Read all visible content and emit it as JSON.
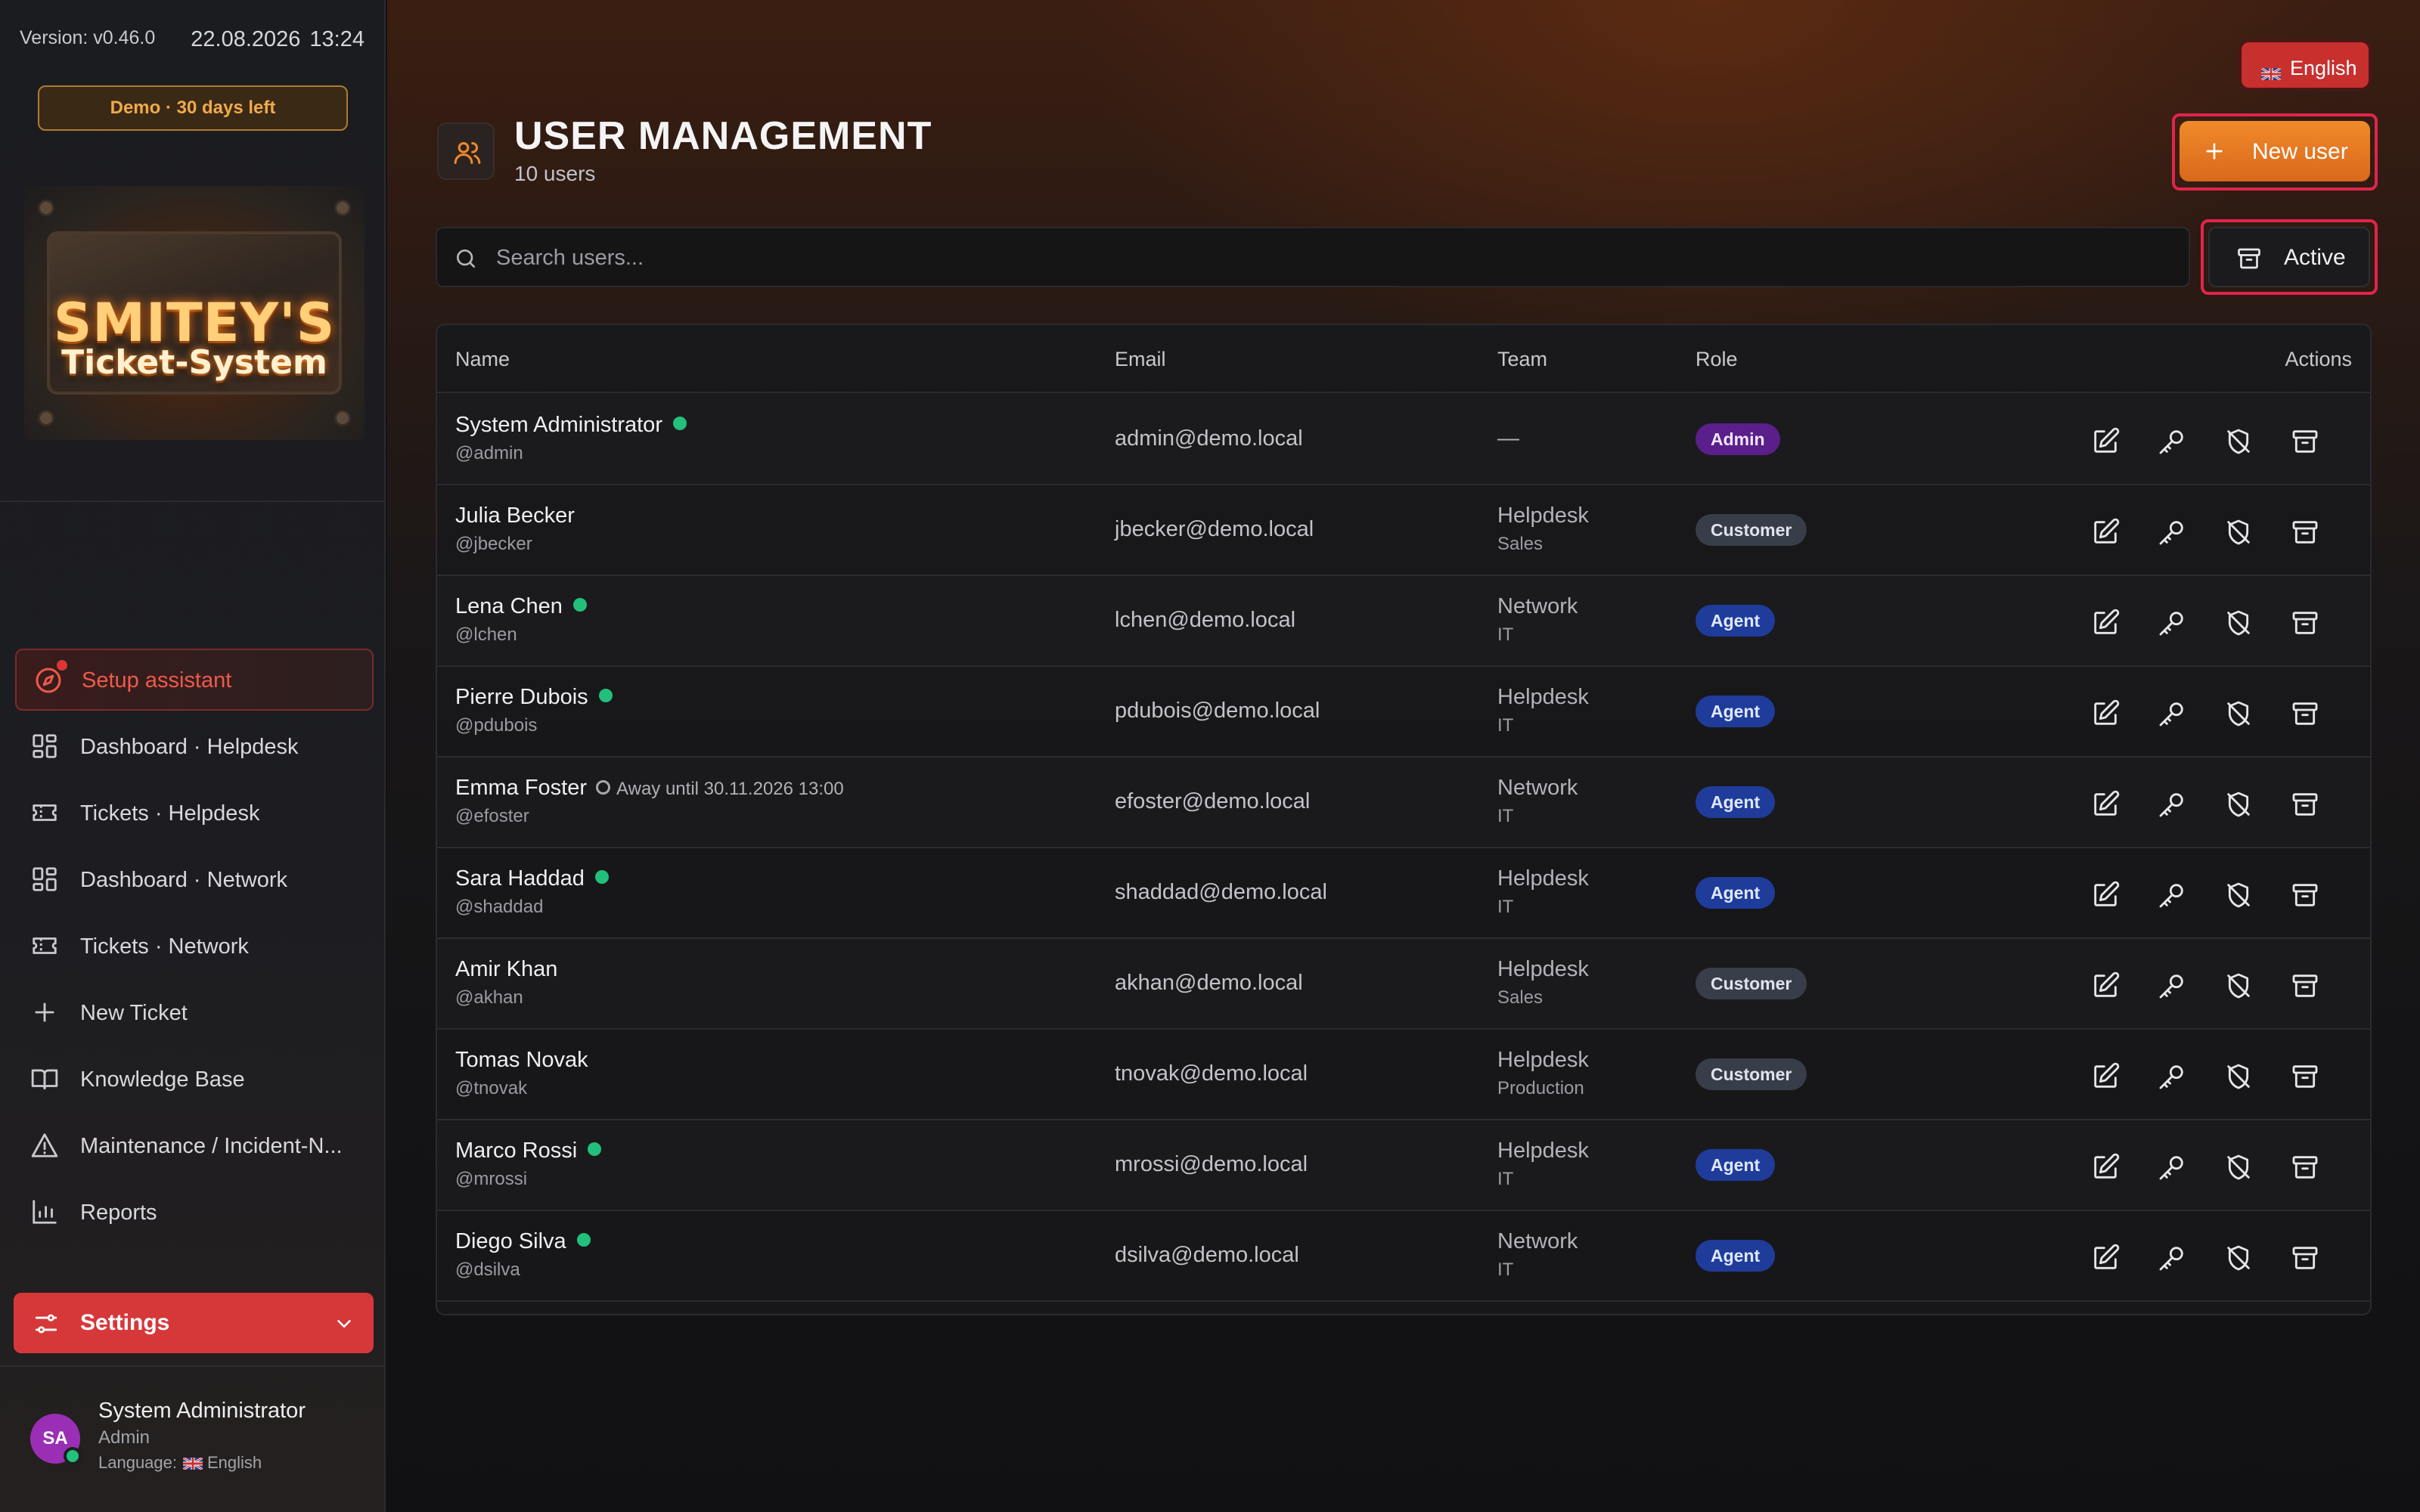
{
  "sidebar": {
    "version": "Version: v0.46.0",
    "date": "22.08.2026",
    "time": "13:24",
    "demo_badge": "Demo · 30 days left",
    "logo_line1": "SMITEY'S",
    "logo_line2": "Ticket-System",
    "setup": "Setup assistant",
    "nav": [
      {
        "label": "Dashboard · Helpdesk",
        "icon": "dashboard-icon"
      },
      {
        "label": "Tickets · Helpdesk",
        "icon": "ticket-icon"
      },
      {
        "label": "Dashboard · Network",
        "icon": "dashboard-icon"
      },
      {
        "label": "Tickets · Network",
        "icon": "ticket-icon"
      },
      {
        "label": "New Ticket",
        "icon": "plus-icon"
      },
      {
        "label": "Knowledge Base",
        "icon": "book-icon"
      },
      {
        "label": "Maintenance / Incident-N...",
        "icon": "warning-icon"
      },
      {
        "label": "Reports",
        "icon": "chart-icon"
      }
    ],
    "settings": "Settings",
    "user": {
      "initials": "SA",
      "name": "System Administrator",
      "role": "Admin",
      "language_label": "Language:",
      "language": "English"
    }
  },
  "header": {
    "language_button": "English",
    "title": "USER MANAGEMENT",
    "subtitle": "10 users",
    "new_user": "New user",
    "search_placeholder": "Search users...",
    "filter": "Active"
  },
  "table": {
    "columns": [
      "Name",
      "Email",
      "Team",
      "Role",
      "Actions"
    ],
    "rows": [
      {
        "name": "System Administrator",
        "handle": "@admin",
        "email": "admin@demo.local",
        "team": "—",
        "team_sub": "",
        "role": "Admin",
        "status": "online"
      },
      {
        "name": "Julia Becker",
        "handle": "@jbecker",
        "email": "jbecker@demo.local",
        "team": "Helpdesk",
        "team_sub": "Sales",
        "role": "Customer",
        "status": "offline"
      },
      {
        "name": "Lena Chen",
        "handle": "@lchen",
        "email": "lchen@demo.local",
        "team": "Network",
        "team_sub": "IT",
        "role": "Agent",
        "status": "online"
      },
      {
        "name": "Pierre Dubois",
        "handle": "@pdubois",
        "email": "pdubois@demo.local",
        "team": "Helpdesk",
        "team_sub": "IT",
        "role": "Agent",
        "status": "online"
      },
      {
        "name": "Emma Foster",
        "handle": "@efoster",
        "email": "efoster@demo.local",
        "team": "Network",
        "team_sub": "IT",
        "role": "Agent",
        "status": "away",
        "away_text": "Away until 30.11.2026 13:00"
      },
      {
        "name": "Sara Haddad",
        "handle": "@shaddad",
        "email": "shaddad@demo.local",
        "team": "Helpdesk",
        "team_sub": "IT",
        "role": "Agent",
        "status": "online"
      },
      {
        "name": "Amir Khan",
        "handle": "@akhan",
        "email": "akhan@demo.local",
        "team": "Helpdesk",
        "team_sub": "Sales",
        "role": "Customer",
        "status": "offline"
      },
      {
        "name": "Tomas Novak",
        "handle": "@tnovak",
        "email": "tnovak@demo.local",
        "team": "Helpdesk",
        "team_sub": "Production",
        "role": "Customer",
        "status": "offline"
      },
      {
        "name": "Marco Rossi",
        "handle": "@mrossi",
        "email": "mrossi@demo.local",
        "team": "Helpdesk",
        "team_sub": "IT",
        "role": "Agent",
        "status": "online"
      },
      {
        "name": "Diego Silva",
        "handle": "@dsilva",
        "email": "dsilva@demo.local",
        "team": "Network",
        "team_sub": "IT",
        "role": "Agent",
        "status": "online"
      }
    ],
    "actions": [
      "edit-icon",
      "key-icon",
      "shield-off-icon",
      "archive-icon"
    ]
  },
  "colors": {
    "accent_orange": "#e8781f",
    "settings_red": "#d6383a",
    "online_green": "#22c07a",
    "admin_badge": "#5a1f8a",
    "agent_badge": "#1f3c9a",
    "customer_badge": "#383d4a"
  }
}
